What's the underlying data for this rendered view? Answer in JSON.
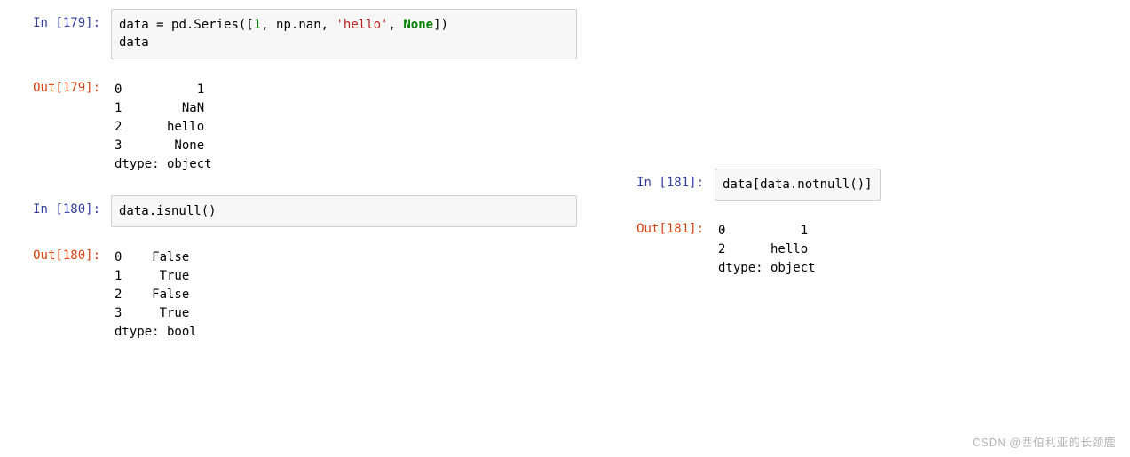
{
  "prompt": {
    "in_label": "In ",
    "out_label": "Out"
  },
  "cells": {
    "c179": {
      "num": "179",
      "code_pre": "data ",
      "op": "=",
      "pd_call": " pd.Series([",
      "one": "1",
      "comma1": ", np.nan, ",
      "hello": "'hello'",
      "comma2": ", ",
      "none": "None",
      "close": "])",
      "line2": "data",
      "out": "0          1\n1        NaN\n2      hello\n3       None\ndtype: object"
    },
    "c180": {
      "num": "180",
      "code": "data.isnull()",
      "out": "0    False\n1     True\n2    False\n3     True\ndtype: bool"
    },
    "c181": {
      "num": "181",
      "code": "data[data.notnull()]",
      "out": "0          1\n2      hello\ndtype: object"
    }
  },
  "watermark": "CSDN @西伯利亚的长颈鹿"
}
